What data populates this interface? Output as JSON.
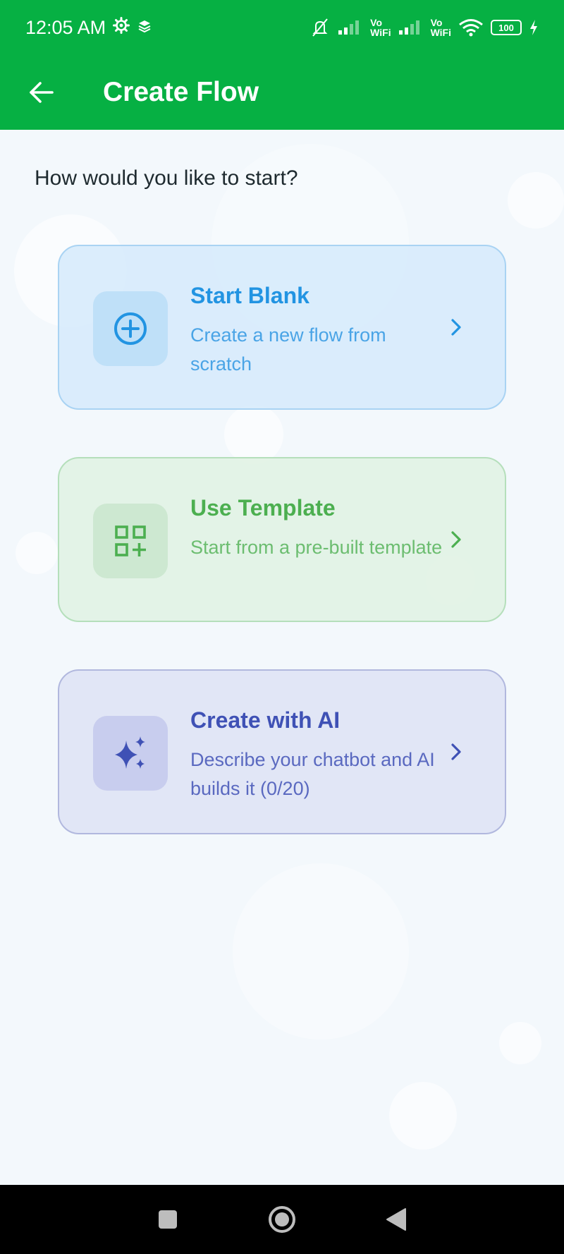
{
  "status_bar": {
    "time": "12:05 AM",
    "battery": "100",
    "wifi_label_1_top": "Vo",
    "wifi_label_1_bottom": "WiFi",
    "wifi_label_2_top": "Vo",
    "wifi_label_2_bottom": "WiFi",
    "icons": [
      "gear-icon",
      "layers-icon",
      "bell-off-icon",
      "signal-icon",
      "signal-icon",
      "wifi-icon",
      "battery-icon",
      "charging-icon"
    ]
  },
  "app_bar": {
    "title": "Create Flow",
    "back_icon": "arrow-left-icon"
  },
  "main": {
    "prompt": "How would you like to start?",
    "options": [
      {
        "title": "Start Blank",
        "description": "Create a new flow from scratch",
        "icon": "plus-circle-icon",
        "color": "#2294e2"
      },
      {
        "title": "Use Template",
        "description": "Start from a pre-built template",
        "icon": "grid-add-icon",
        "color": "#4caf50"
      },
      {
        "title": "Create with AI",
        "description": "Describe your chatbot and AI builds it (0/20)",
        "icon": "sparkles-icon",
        "color": "#3f51b5"
      }
    ]
  },
  "colors": {
    "primary": "#06b043",
    "nav_bar": "#000000"
  },
  "nav": {
    "icons": [
      "square-icon",
      "circle-home-icon",
      "triangle-back-icon"
    ]
  }
}
